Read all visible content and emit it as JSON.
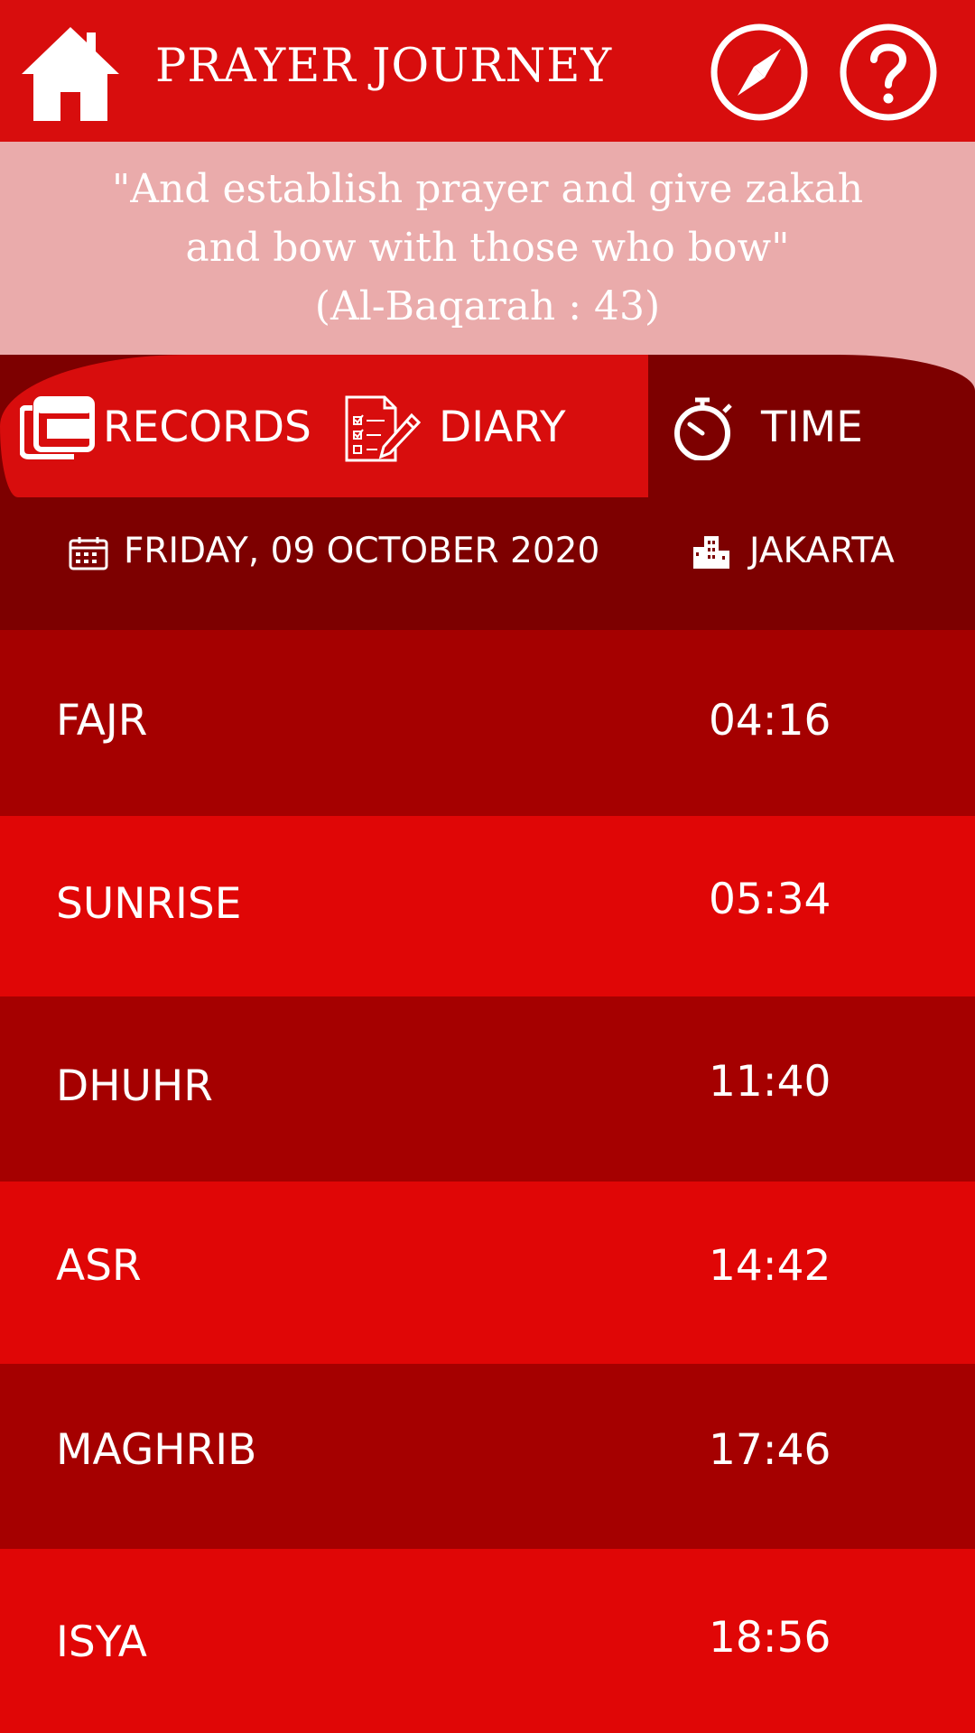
{
  "header": {
    "title": "PRAYER JOURNEY",
    "icons": [
      "home-icon",
      "compass-icon",
      "help-icon"
    ],
    "background": "#d80d0d"
  },
  "quote": {
    "line1": "\"And establish prayer and give zakah",
    "line2": "and bow with those who bow\"",
    "line3": "(Al-Baqarah : 43)"
  },
  "tabs": [
    {
      "label": "RECORDS",
      "icon": "books-icon",
      "active": false
    },
    {
      "label": "DIARY",
      "icon": "checklist-pencil-icon",
      "active": false
    },
    {
      "label": "TIME",
      "icon": "stopwatch-icon",
      "active": true
    }
  ],
  "info": {
    "date": "FRIDAY, 09 OCTOBER 2020",
    "city": "JAKARTA"
  },
  "prayers": [
    {
      "name": "FAJR",
      "time": "04:16"
    },
    {
      "name": "SUNRISE",
      "time": "05:34"
    },
    {
      "name": "DHUHR",
      "time": "11:40"
    },
    {
      "name": "ASR",
      "time": "14:42"
    },
    {
      "name": "MAGHRIB",
      "time": "17:46"
    },
    {
      "name": "ISYA",
      "time": "18:56"
    }
  ],
  "colors": {
    "accent": "#d80d0d",
    "dark": "#7d0000",
    "row_dark": "#a50000",
    "row_light": "#e00606",
    "quote_bg": "#eaabab"
  }
}
